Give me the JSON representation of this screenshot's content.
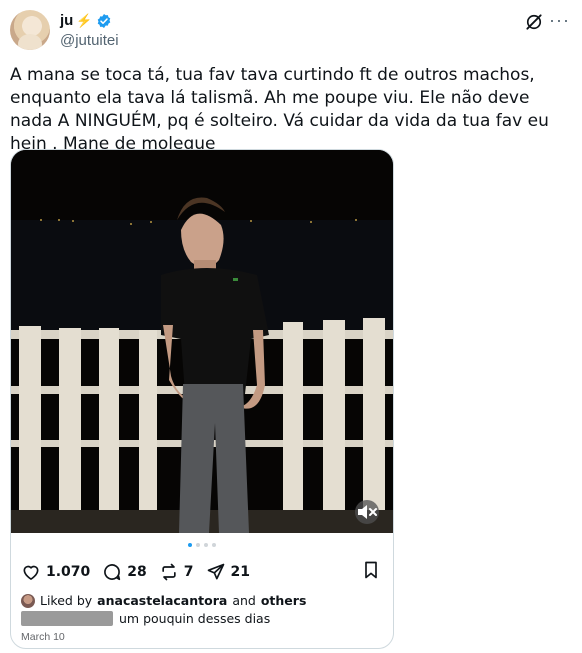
{
  "author": {
    "display_name": "ju",
    "name_emoji": "⚡",
    "handle": "@jutuitei",
    "verified": true
  },
  "header_icons": {
    "grok": "grok-icon",
    "more": "···"
  },
  "tweet": {
    "text": "A mana se toca tá, tua fav tava curtindo ft de outros machos, enquanto ela tava lá talismã. Ah me poupe viu. Ele não deve nada  A NINGUÉM, pq é solteiro. Vá cuidar da vida da tua fav eu hein . Mane de moleque"
  },
  "embedded_post": {
    "photo_alt": "man in black polo shirt and grey jeans leaning on white wooden fence at night",
    "carousel": {
      "count": 4,
      "active_index": 0
    },
    "stats": {
      "likes": "1.070",
      "comments": "28",
      "reposts": "7",
      "shares": "21"
    },
    "liked_by": {
      "prefix": "Liked by",
      "user": "anacastelacantora",
      "middle": "and",
      "suffix": "others"
    },
    "caption": "um pouquin desses dias",
    "date": "March 10"
  },
  "colors": {
    "accent": "#1d9bf0",
    "text": "#0f1419",
    "muted": "#536471",
    "border": "#cfd9de"
  }
}
